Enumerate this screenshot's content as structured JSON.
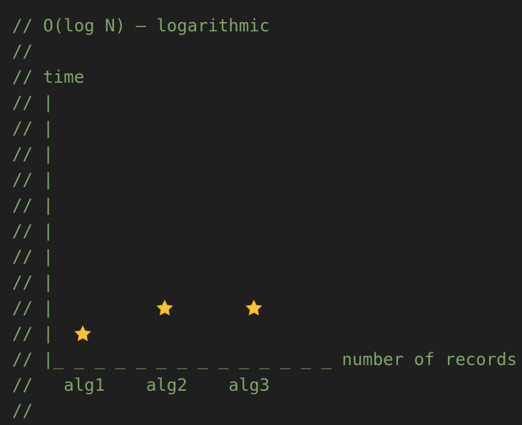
{
  "editor": {
    "text_color": "#7fa36a",
    "background": "#1f1f1f",
    "lines": [
      "// O(log N) – logarithmic",
      "//",
      "// time",
      "// |",
      "// |",
      "// |",
      "// |",
      "// |",
      "// |",
      "// |",
      "// |",
      "// |",
      "// |",
      "// |_ _ _ _ _ _ _ _ _ _ _ _ _ _ number of records",
      "//   alg1    alg2    alg3",
      "//"
    ],
    "star_icon": "star-emoji",
    "star_color": "#f7c531"
  }
}
